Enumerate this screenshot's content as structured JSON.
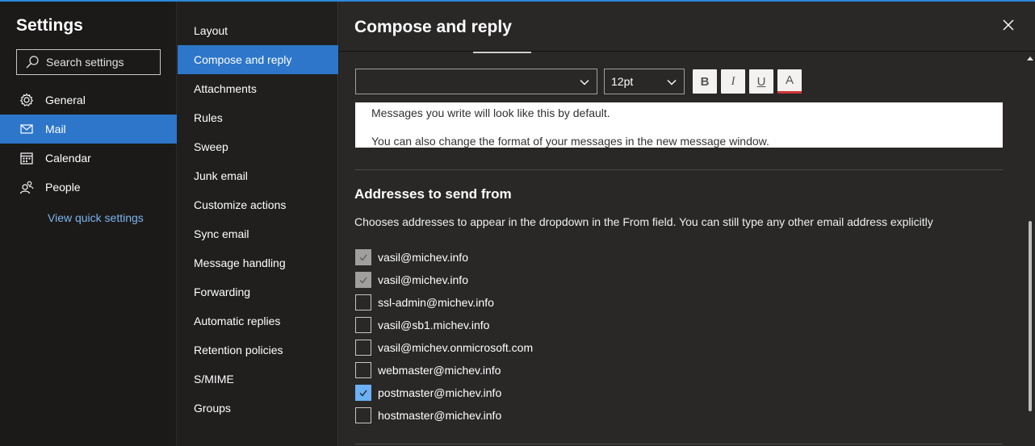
{
  "left": {
    "title": "Settings",
    "search_placeholder": "Search settings",
    "items": [
      {
        "label": "General",
        "icon": "gear-icon"
      },
      {
        "label": "Mail",
        "icon": "mail-icon"
      },
      {
        "label": "Calendar",
        "icon": "calendar-icon"
      },
      {
        "label": "People",
        "icon": "people-icon"
      }
    ],
    "quick_link": "View quick settings"
  },
  "mid": {
    "items": [
      "Layout",
      "Compose and reply",
      "Attachments",
      "Rules",
      "Sweep",
      "Junk email",
      "Customize actions",
      "Sync email",
      "Message handling",
      "Forwarding",
      "Automatic replies",
      "Retention policies",
      "S/MIME",
      "Groups"
    ],
    "active_index": 1
  },
  "right": {
    "title": "Compose and reply",
    "font_value": "",
    "size_value": "12pt",
    "format_buttons": [
      "B",
      "I",
      "U",
      "A"
    ],
    "preview_line1": "Messages you write will look like this by default.",
    "preview_line2": "You can also change the format of your messages in the new message window.",
    "section_title": "Addresses to send from",
    "section_desc": "Chooses addresses to appear in the dropdown in the From field. You can still type any other email address explicitly",
    "addresses": [
      {
        "email": "vasil@michev.info",
        "state": "checked-disabled"
      },
      {
        "email": "vasil@michev.info",
        "state": "checked-disabled"
      },
      {
        "email": "ssl-admin@michev.info",
        "state": "unchecked"
      },
      {
        "email": "vasil@sb1.michev.info",
        "state": "unchecked"
      },
      {
        "email": "vasil@michev.onmicrosoft.com",
        "state": "unchecked"
      },
      {
        "email": "webmaster@michev.info",
        "state": "unchecked"
      },
      {
        "email": "postmaster@michev.info",
        "state": "checked"
      },
      {
        "email": "hostmaster@michev.info",
        "state": "unchecked"
      }
    ]
  },
  "colors": {
    "accent": "#2d76c9",
    "link": "#7cb4f0",
    "checked": "#6cb0f5"
  }
}
